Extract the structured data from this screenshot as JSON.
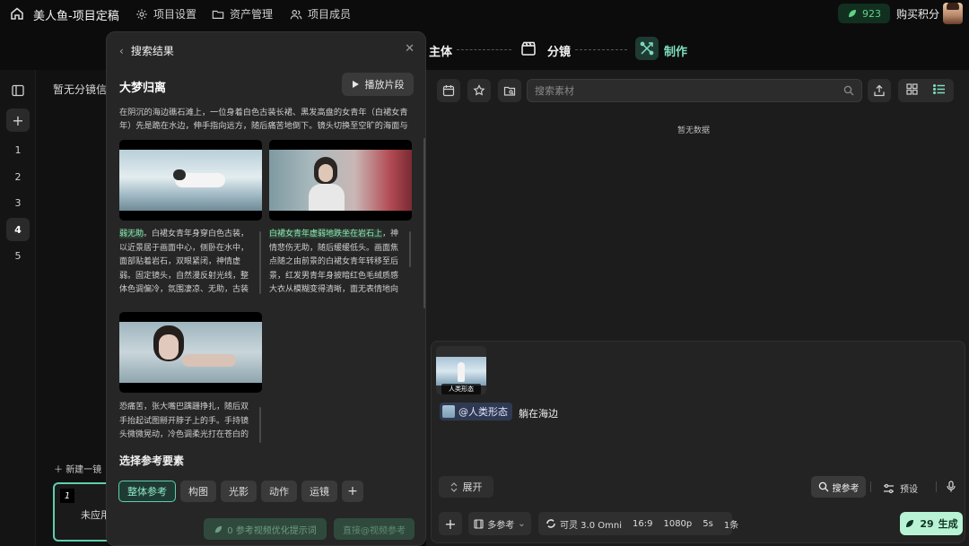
{
  "app": {
    "project_title": "美人鱼-项目定稿",
    "nav": [
      {
        "label": "项目设置",
        "icon": "gear-icon"
      },
      {
        "label": "资产管理",
        "icon": "folder-icon"
      },
      {
        "label": "项目成员",
        "icon": "members-icon"
      }
    ],
    "credits": "923",
    "buy_label": "购买积分"
  },
  "steps": [
    {
      "label": "主体",
      "state": "done"
    },
    {
      "label": "分镜",
      "state": "done"
    },
    {
      "label": "制作",
      "state": "active"
    }
  ],
  "rail": {
    "numbers": [
      "1",
      "2",
      "3",
      "4",
      "5"
    ],
    "active": "4"
  },
  "shots": {
    "empty_label": "暂无分镜信",
    "new_shot_label": "新建一镜",
    "card_number": "1",
    "card_status": "未应用"
  },
  "search_panel": {
    "title": "搜索结果",
    "result_title": "大梦归离",
    "play_label": "播放片段",
    "description": "在阴沉的海边礁石滩上，一位身着白色古装长裙、黑发高盘的女青年（白裙女青年）先是跪在水边，伸手指向远方，随后痛苦地倒下。镜头切换至空旷的海面与陡峭...",
    "clips": [
      {
        "highlight": "弱无助",
        "text": "。白裙女青年身穿白色古装，以近景居于画面中心，侧卧在水中，面部贴着岩石，双眼紧闭，神情虚弱。固定镜头，自然漫反射光线，整体色调偏冷，氛围凄凉、无助，古装剧情风格。"
      },
      {
        "highlight": "白裙女青年虚弱地跌坐在岩石上",
        "text": "，神情悲伤无助，随后缓缓低头。画面焦点随之由前景的白裙女青年转移至后景，红发男青年身披暗红色毛绒质感大衣从模糊变得清晰，面无表情地向前走来。镜"
      },
      {
        "highlight": "",
        "text": "恐痛苦，张大嘴巴蹒跚挣扎，随后双手抬起试图掰开脖子上的手。手持镜头微微晃动，冷色调柔光打在苍白的脸上，"
      }
    ],
    "ref_title": "选择参考要素",
    "ref_chips": [
      "整体参考",
      "构图",
      "光影",
      "动作",
      "运镜"
    ],
    "optimize_label": "0 参考视频优化提示词",
    "direct_label": "直接@视频参考"
  },
  "assets": {
    "search_placeholder": "搜索素材",
    "empty": "暂无数据"
  },
  "composer": {
    "thumb_label": "人类形态",
    "mention": "@人类形态",
    "prompt": "躺在海边",
    "expand_label": "展开",
    "search_ref_label": "搜参考",
    "preset_label": "预设",
    "multi_ref_label": "多参考",
    "model": "可灵 3.0 Omni",
    "ratio": "16:9",
    "resolution": "1080p",
    "duration": "5s",
    "count": "1条",
    "gen_cost": "29",
    "gen_label": "生成"
  },
  "colors": {
    "accent": "#5fcfae",
    "credit": "#5fd28a",
    "gen_bg": "#b9f3d5"
  }
}
